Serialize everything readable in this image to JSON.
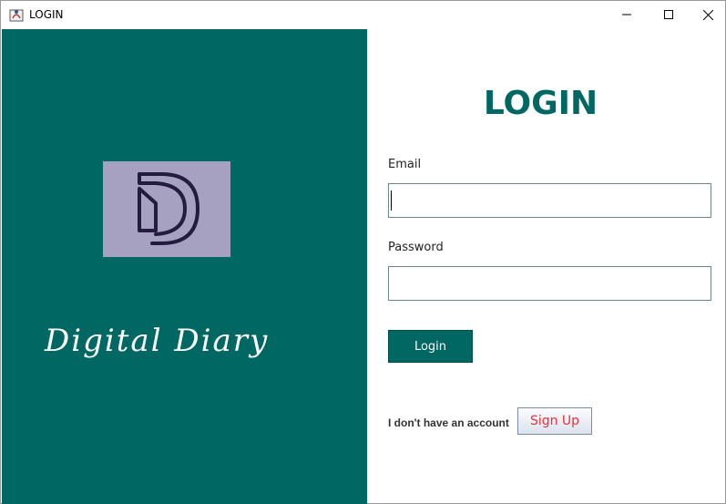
{
  "window": {
    "title": "LOGIN",
    "icons": {
      "app": "java-app-icon",
      "minimize": "minimize-icon",
      "maximize": "maximize-icon",
      "close": "close-icon"
    }
  },
  "brand": {
    "logo_icon": "dd-logo-icon",
    "name": "Digital Diary"
  },
  "form": {
    "heading": "LOGIN",
    "email_label": "Email",
    "email_value": "",
    "password_label": "Password",
    "password_value": "",
    "login_label": "Login",
    "no_account_text": "I don't have an account",
    "signup_label": "Sign Up"
  },
  "colors": {
    "primary": "#006763",
    "logo_bg": "#a7a1c1",
    "signup_text": "#e8303a"
  }
}
